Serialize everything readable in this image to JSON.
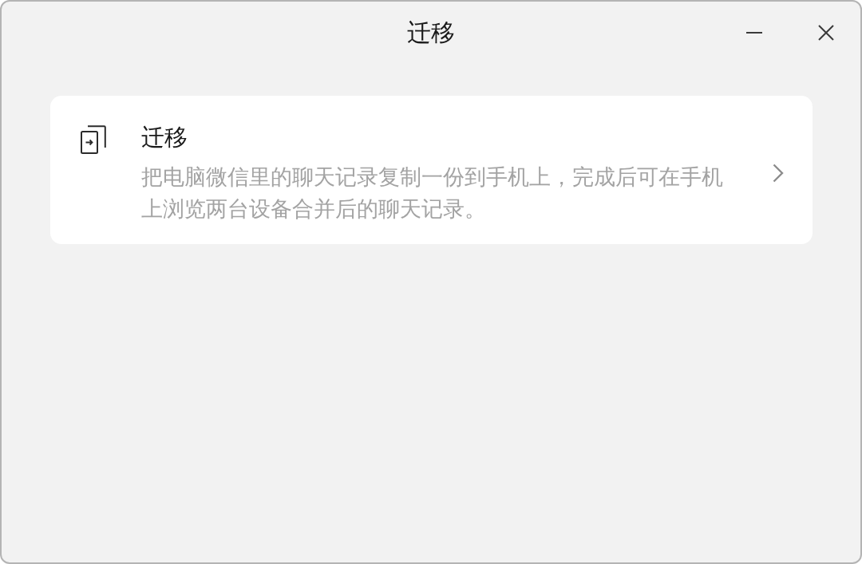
{
  "window": {
    "title": "迁移"
  },
  "card": {
    "title": "迁移",
    "description": "把电脑微信里的聊天记录复制一份到手机上，完成后可在手机上浏览两台设备合并后的聊天记录。"
  }
}
